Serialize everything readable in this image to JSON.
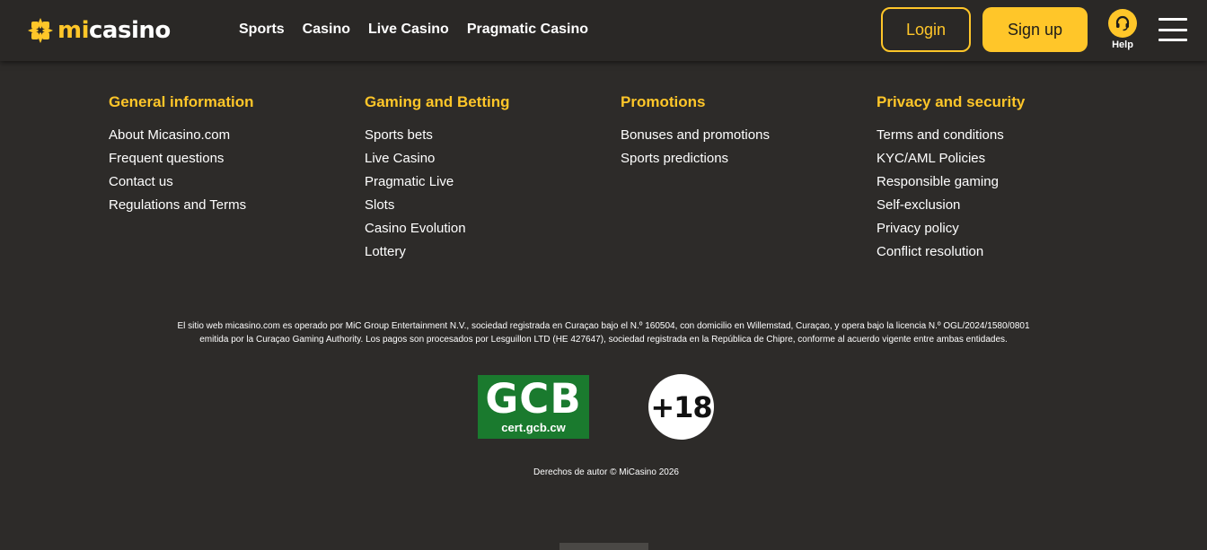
{
  "header": {
    "logo_mi": "mi",
    "logo_casino": "casino",
    "nav": [
      "Sports",
      "Casino",
      "Live Casino",
      "Pragmatic Casino"
    ],
    "login_label": "Login",
    "signup_label": "Sign up",
    "help_label": "Help"
  },
  "footer": {
    "columns": [
      {
        "title": "General information",
        "links": [
          "About Micasino.com",
          "Frequent questions",
          "Contact us",
          "Regulations and Terms"
        ]
      },
      {
        "title": "Gaming and Betting",
        "links": [
          "Sports bets",
          "Live Casino",
          "Pragmatic Live",
          "Slots",
          "Casino Evolution",
          "Lottery"
        ]
      },
      {
        "title": "Promotions",
        "links": [
          "Bonuses and promotions",
          "Sports predictions"
        ]
      },
      {
        "title": "Privacy and security",
        "links": [
          "Terms and conditions",
          "KYC/AML Policies",
          "Responsible gaming",
          "Self-exclusion",
          "Privacy policy",
          "Conflict resolution"
        ]
      }
    ],
    "legal_line1": "El sitio web micasino.com es operado por MiC Group Entertainment N.V., sociedad registrada en Curaçao bajo el N.º 160504, con domicilio en Willemstad, Curaçao, y opera bajo la licencia N.º OGL/2024/1580/0801",
    "legal_line2": "emitida por la Curaçao Gaming Authority. Los pagos son procesados por Lesguillon LTD (HE 427647), sociedad registrada en la República de Chipre, conforme al acuerdo vigente entre ambas entidades.",
    "gcb_big": "GCB",
    "gcb_small": "cert.gcb.cw",
    "age_badge": "+18",
    "copyright": "Derechos de autor © MiCasino 2026"
  },
  "colors": {
    "background": "#2d2b29",
    "header": "#2a2826",
    "accent": "#ffc629",
    "gcb_green": "#1a7a2e"
  },
  "icons": {
    "logo": "four-petal-logo-icon",
    "help": "headset-icon",
    "menu": "hamburger-menu-icon"
  }
}
